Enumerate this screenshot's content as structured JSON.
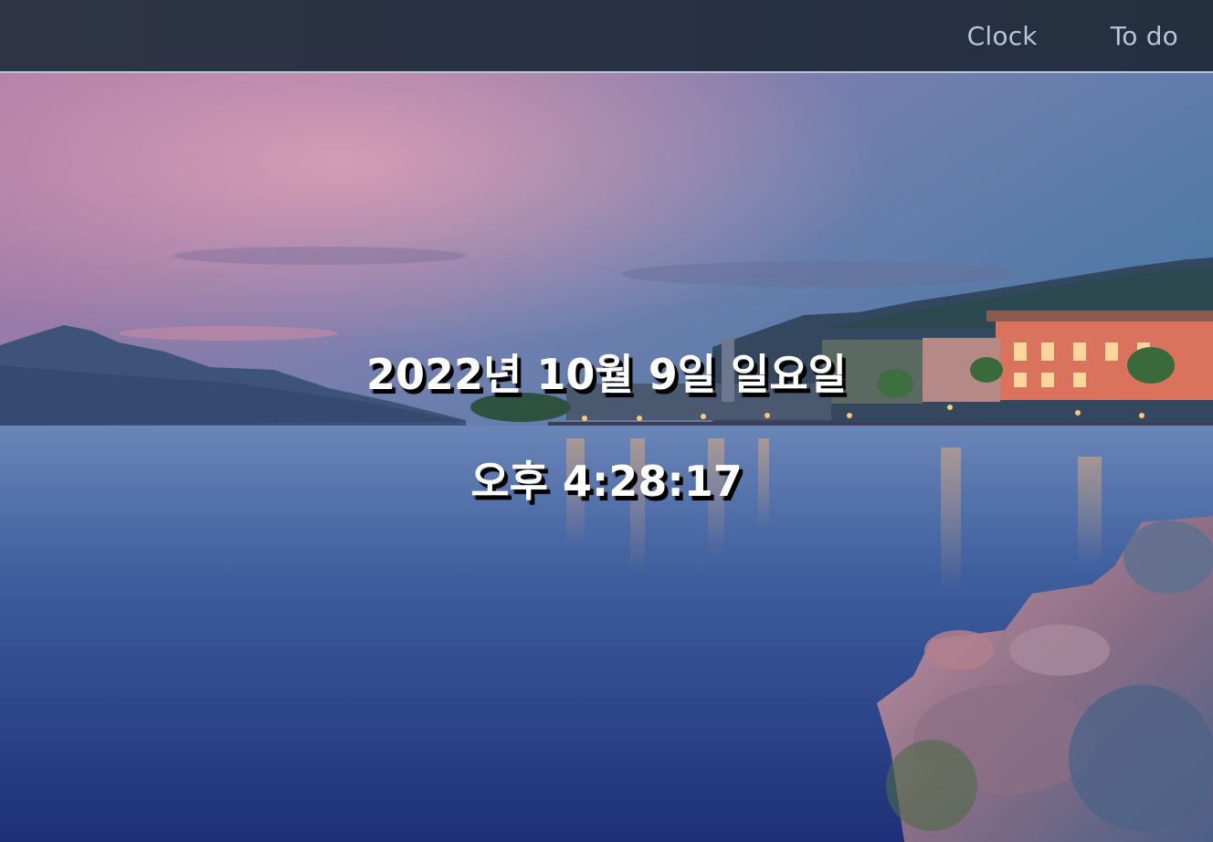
{
  "navbar": {
    "links": [
      {
        "label": "Clock"
      },
      {
        "label": "To do"
      }
    ]
  },
  "clock": {
    "date": "2022년 10월 9일 일요일",
    "time": "오후 4:28:17"
  },
  "colors": {
    "navbar_bg": "#283145",
    "nav_link": "#b7c6d6",
    "clock_text": "#ffffff",
    "clock_shadow": "#000000"
  },
  "background": {
    "scene": "lakeside-town-at-dusk"
  }
}
